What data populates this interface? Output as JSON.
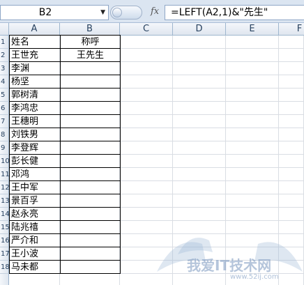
{
  "formula_bar": {
    "name_box": "B2",
    "fx_icon": "fx",
    "formula": "=LEFT(A2,1)&\"先生\""
  },
  "columns": [
    "A",
    "B",
    "C",
    "D",
    "E",
    "F"
  ],
  "rows": [
    {
      "row": "1",
      "a": "姓名",
      "b": "称呼"
    },
    {
      "row": "2",
      "a": "王世充",
      "b": "王先生"
    },
    {
      "row": "3",
      "a": "李渊",
      "b": ""
    },
    {
      "row": "4",
      "a": "杨坚",
      "b": ""
    },
    {
      "row": "5",
      "a": "郭树清",
      "b": ""
    },
    {
      "row": "6",
      "a": "李鸿忠",
      "b": ""
    },
    {
      "row": "7",
      "a": "王穗明",
      "b": ""
    },
    {
      "row": "8",
      "a": "刘铁男",
      "b": ""
    },
    {
      "row": "9",
      "a": "李登辉",
      "b": ""
    },
    {
      "row": "10",
      "a": "彭长健",
      "b": ""
    },
    {
      "row": "11",
      "a": "邓鸿",
      "b": ""
    },
    {
      "row": "12",
      "a": "王中军",
      "b": ""
    },
    {
      "row": "13",
      "a": "景百孚",
      "b": ""
    },
    {
      "row": "14",
      "a": "赵永亮",
      "b": ""
    },
    {
      "row": "15",
      "a": "陆兆禧",
      "b": ""
    },
    {
      "row": "16",
      "a": "严介和",
      "b": ""
    },
    {
      "row": "17",
      "a": "王小波",
      "b": ""
    },
    {
      "row": "18",
      "a": "马未都",
      "b": ""
    }
  ],
  "watermark": {
    "text": "我爱IT技术网",
    "url": "www.52ij.com"
  },
  "colors": {
    "header_bg": "#dfe6ef",
    "header_border": "#9eb6ce",
    "gridline": "#d9dde3",
    "formula_bar_bg": "#dbe5f1"
  }
}
